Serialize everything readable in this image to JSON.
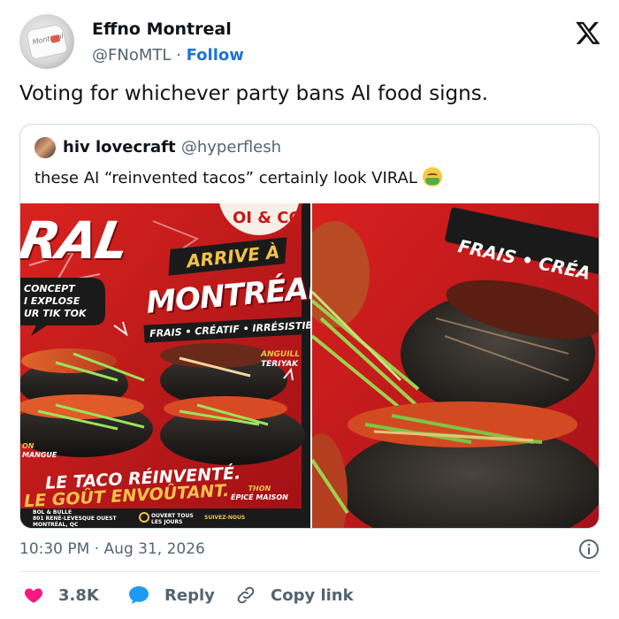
{
  "author": {
    "name": "Effno Montreal",
    "handle": "@FNoMTL",
    "separator": "·",
    "follow_label": "Follow",
    "avatar_text": "Montreal"
  },
  "tweet": {
    "text": "Voting for whichever party bans AI food signs."
  },
  "quote": {
    "name": "hiv lovecraft",
    "handle": "@hyperflesh",
    "text": "these AI “reinvented tacos” certainly look VIRAL",
    "emoji": "nauseated-face-emoji"
  },
  "poster": {
    "left": {
      "headline": "RAL",
      "badge_top": "OI & CO",
      "arrive": "ARRIVE À",
      "city": "MONTRÉAL",
      "tagline": "FRAIS • CRÉATIF • IRRÉSISTIBL",
      "concept_1": "CONCEPT",
      "concept_2": "I EXPLOSE",
      "concept_3": "UR TIK TOK",
      "anguille_1": "ANGUILL",
      "anguille_2": "TERIYAK",
      "side_1": "ON",
      "side_2": "MANGUE",
      "slogan_1": "LE TACO RÉINVENTÉ.",
      "slogan_2": "LE GOÛT ENVOÛTANT.",
      "thon_1": "THON",
      "thon_2": "ÉPICÉ MAISON",
      "addr_1": "BOL & BULLE",
      "addr_2": "801 RENÉ-LEVESQUE OUEST",
      "addr_3": "MONTRÉAL, QC",
      "open_1": "OUVERT TOUS",
      "open_2": "LES JOURS",
      "follow": "SUIVEZ-NOUS"
    },
    "right": {
      "banner": "FRAIS • CRÉA"
    }
  },
  "meta": {
    "time": "10:30 PM",
    "dot": "·",
    "date": "Aug 31, 2026"
  },
  "actions": {
    "likes": "3.8K",
    "reply_label": "Reply",
    "copy_label": "Copy link"
  },
  "colors": {
    "like_heart": "#f91880",
    "reply_bubble": "#1d9bf0",
    "link_blue": "#1d74d5",
    "poster_red": "#c91d1d"
  }
}
